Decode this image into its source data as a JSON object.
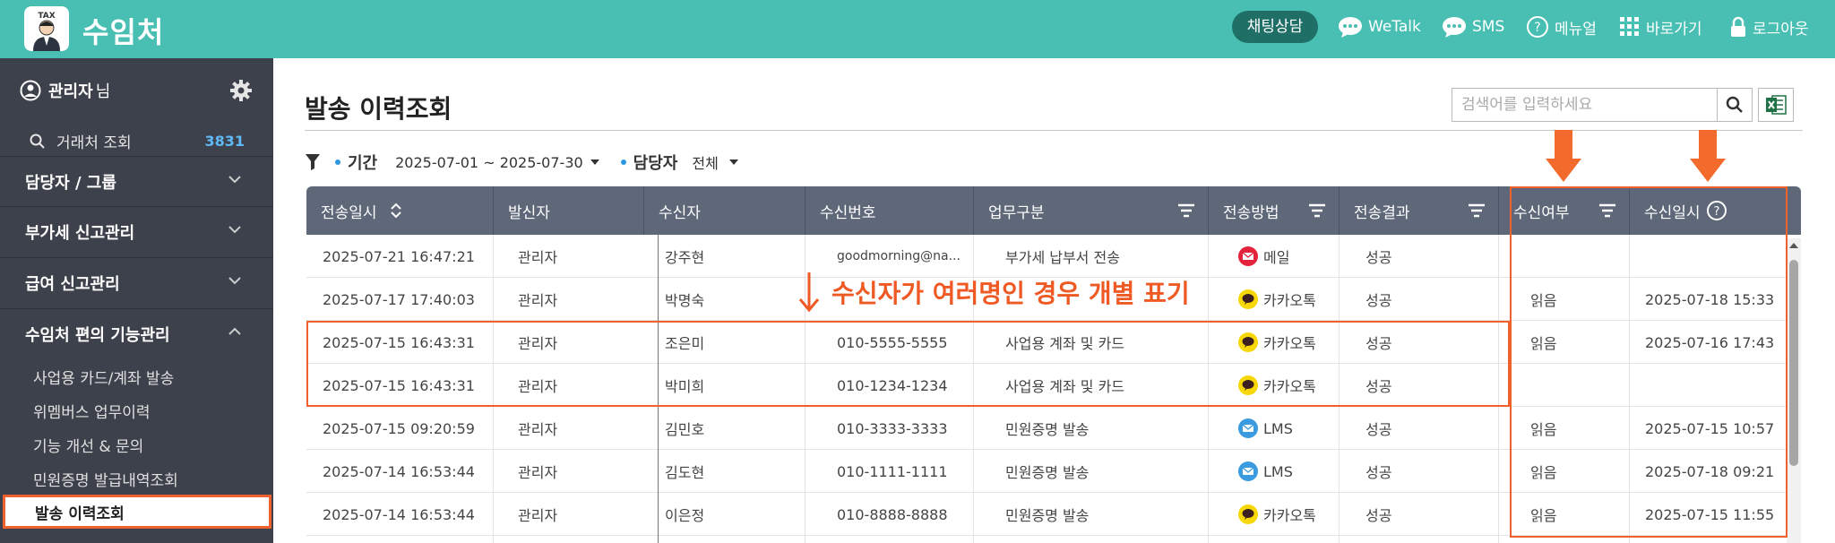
{
  "header": {
    "app_title": "수임처",
    "logo_text": "TAX",
    "chat_consult": "채팅상담",
    "nav": [
      {
        "label": "WeTalk",
        "icon": "chat-bubble-icon"
      },
      {
        "label": "SMS",
        "icon": "chat-bubble-icon"
      },
      {
        "label": "메뉴얼",
        "icon": "help-circle-icon"
      },
      {
        "label": "바로가기",
        "icon": "grid-icon"
      },
      {
        "label": "로그아웃",
        "icon": "lock-icon"
      }
    ]
  },
  "sidebar": {
    "admin_name": "관리자",
    "admin_suffix": "님",
    "client_search": {
      "label": "거래처 조회",
      "count": "3831"
    },
    "groups": [
      {
        "label": "담당자 / 그룹",
        "expanded": false
      },
      {
        "label": "부가세 신고관리",
        "expanded": false
      },
      {
        "label": "급여 신고관리",
        "expanded": false
      },
      {
        "label": "수임처 편의 기능관리",
        "expanded": true
      }
    ],
    "submenu": [
      {
        "label": "사업용 카드/계좌 발송",
        "active": false
      },
      {
        "label": "위멤버스 업무이력",
        "active": false
      },
      {
        "label": "기능 개선 & 문의",
        "active": false
      },
      {
        "label": "민원증명 발급내역조회",
        "active": false
      },
      {
        "label": "발송 이력조회",
        "active": true
      }
    ]
  },
  "main": {
    "page_title": "발송 이력조회",
    "search_placeholder": "검색어를 입력하세요",
    "filters": {
      "period_label": "기간",
      "period_value": "2025-07-01 ~ 2025-07-30",
      "manager_label": "담당자",
      "manager_value": "전체"
    },
    "annotation": "수신자가 여러명인 경우 개별 표기",
    "columns": [
      "전송일시",
      "발신자",
      "수신자",
      "수신번호",
      "업무구분",
      "전송방법",
      "전송결과",
      "수신여부",
      "수신일시"
    ],
    "rows": [
      {
        "sent_at": "2025-07-21 16:47:21",
        "sender": "관리자",
        "recipient": "강주현",
        "number": "goodmorning@na...",
        "task": "부가세 납부서 전송",
        "method": "메일",
        "method_type": "mail",
        "result": "성공",
        "read": "",
        "read_at": ""
      },
      {
        "sent_at": "2025-07-17 17:40:03",
        "sender": "관리자",
        "recipient": "박명숙",
        "number": "",
        "task": "",
        "method": "카카오톡",
        "method_type": "kakao",
        "result": "성공",
        "read": "읽음",
        "read_at": "2025-07-18 15:33"
      },
      {
        "sent_at": "2025-07-15 16:43:31",
        "sender": "관리자",
        "recipient": "조은미",
        "number": "010-5555-5555",
        "task": "사업용 계좌 및 카드",
        "method": "카카오톡",
        "method_type": "kakao",
        "result": "성공",
        "read": "읽음",
        "read_at": "2025-07-16 17:43"
      },
      {
        "sent_at": "2025-07-15 16:43:31",
        "sender": "관리자",
        "recipient": "박미희",
        "number": "010-1234-1234",
        "task": "사업용 계좌 및 카드",
        "method": "카카오톡",
        "method_type": "kakao",
        "result": "성공",
        "read": "",
        "read_at": ""
      },
      {
        "sent_at": "2025-07-15 09:20:59",
        "sender": "관리자",
        "recipient": "김민호",
        "number": "010-3333-3333",
        "task": "민원증명 발송",
        "method": "LMS",
        "method_type": "lms",
        "result": "성공",
        "read": "읽음",
        "read_at": "2025-07-15 10:57"
      },
      {
        "sent_at": "2025-07-14 16:53:44",
        "sender": "관리자",
        "recipient": "김도현",
        "number": "010-1111-1111",
        "task": "민원증명 발송",
        "method": "LMS",
        "method_type": "lms",
        "result": "성공",
        "read": "읽음",
        "read_at": "2025-07-18 09:21"
      },
      {
        "sent_at": "2025-07-14 16:53:44",
        "sender": "관리자",
        "recipient": "이은정",
        "number": "010-8888-8888",
        "task": "민원증명 발송",
        "method": "카카오톡",
        "method_type": "kakao",
        "result": "성공",
        "read": "읽음",
        "read_at": "2025-07-15 11:55"
      }
    ]
  },
  "colors": {
    "header_teal": "#49bfb3",
    "sidebar": "#3d414c",
    "table_header": "#5e6879",
    "highlight": "#f0612d",
    "mail": "#e2233b",
    "kakao": "#f7d708",
    "lms": "#3a9be0"
  }
}
